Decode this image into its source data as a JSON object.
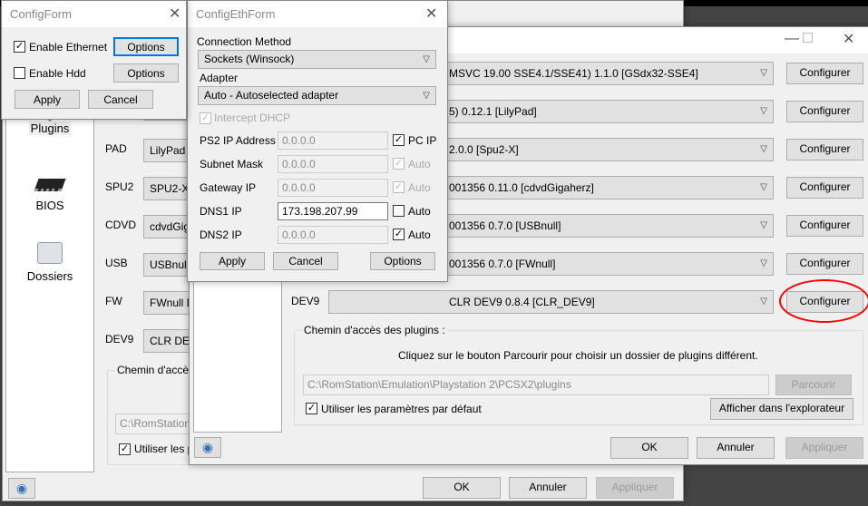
{
  "back_window": {
    "sidebar": [
      {
        "label": "Plugins",
        "icon": "plugins-icon"
      },
      {
        "label": "BIOS",
        "icon": "chip-icon"
      },
      {
        "label": "Dossiers",
        "icon": "folder-icon"
      }
    ],
    "rows": [
      {
        "label": "PAD",
        "value": "LilyPad ("
      },
      {
        "label": "SPU2",
        "value": "SPU2-X 2"
      },
      {
        "label": "CDVD",
        "value": "cdvdGiga"
      },
      {
        "label": "USB",
        "value": "USBnull I"
      },
      {
        "label": "FW",
        "value": "FWnull D"
      },
      {
        "label": "DEV9",
        "value": "CLR DEV9"
      }
    ],
    "group_label": "Chemin d'accès",
    "path": "C:\\RomStation",
    "use_default": "Utiliser les p",
    "ok": "OK",
    "cancel": "Annuler",
    "apply": "Appliquer"
  },
  "main_window": {
    "rows": [
      {
        "label": "",
        "value": "MSVC 19.00 SSE4.1/SSE41) 1.1.0 [GSdx32-SSE4]"
      },
      {
        "label": "",
        "value": "5) 0.12.1 [LilyPad]"
      },
      {
        "label": "",
        "value": "2.0.0 [Spu2-X]"
      },
      {
        "label": "",
        "value": "001356 0.11.0 [cdvdGigaherz]"
      },
      {
        "label": "",
        "value": "001356 0.7.0 [USBnull]"
      },
      {
        "label": "",
        "value": "001356 0.7.0 [FWnull]"
      },
      {
        "label": "DEV9",
        "value": "CLR DEV9 0.8.4 [CLR_DEV9]"
      }
    ],
    "configure_label": "Configurer",
    "group_label": "Chemin d'accès des plugins :",
    "hint": "Cliquez sur le bouton Parcourir pour choisir un dossier de plugins différent.",
    "path": "C:\\RomStation\\Emulation\\Playstation 2\\PCSX2\\plugins",
    "browse": "Parcourir",
    "use_default": "Utiliser les paramètres par défaut",
    "show_explorer": "Afficher dans l'explorateur",
    "ok": "OK",
    "cancel": "Annuler",
    "apply": "Appliquer",
    "highlight_color": "#ff0000"
  },
  "config_form": {
    "title": "ConfigForm",
    "enable_ethernet": "Enable Ethernet",
    "enable_ethernet_checked": true,
    "enable_hdd": "Enable Hdd",
    "enable_hdd_checked": false,
    "options": "Options",
    "apply": "Apply",
    "cancel": "Cancel"
  },
  "eth_form": {
    "title": "ConfigEthForm",
    "connection_method_label": "Connection Method",
    "connection_method": "Sockets (Winsock)",
    "adapter_label": "Adapter",
    "adapter": "Auto - Autoselected adapter",
    "intercept_dhcp": "Intercept DHCP",
    "fields": [
      {
        "label": "PS2 IP Address",
        "value": "0.0.0.0",
        "check": "PC IP",
        "checked": true
      },
      {
        "label": "Subnet Mask",
        "value": "0.0.0.0",
        "check": "Auto",
        "checked": true
      },
      {
        "label": "Gateway IP",
        "value": "0.0.0.0",
        "check": "Auto",
        "checked": true
      },
      {
        "label": "DNS1 IP",
        "value": "173.198.207.99",
        "check": "Auto",
        "checked": false
      },
      {
        "label": "DNS2 IP",
        "value": "0.0.0.0",
        "check": "Auto",
        "checked": true
      }
    ],
    "apply": "Apply",
    "cancel": "Cancel",
    "options": "Options"
  }
}
